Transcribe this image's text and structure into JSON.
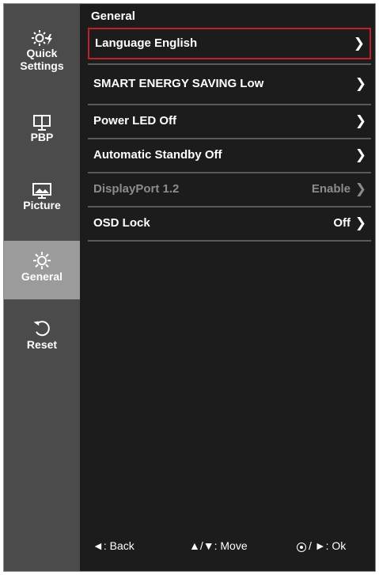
{
  "sidebar": {
    "items": [
      {
        "label_line1": "Quick",
        "label_line2": "Settings",
        "icon": "quick-settings-icon"
      },
      {
        "label": "PBP",
        "icon": "pbp-icon"
      },
      {
        "label": "Picture",
        "icon": "picture-icon"
      },
      {
        "label": "General",
        "icon": "gear-icon",
        "active": true
      },
      {
        "label": "Reset",
        "icon": "reset-icon"
      }
    ]
  },
  "main": {
    "title": "General",
    "rows": [
      {
        "label": "Language English",
        "value": "",
        "chevron": "❯",
        "selected": true
      },
      {
        "label": "SMART ENERGY SAVING Low",
        "value": "",
        "chevron": "❯"
      },
      {
        "label": "Power LED Off",
        "value": "",
        "chevron": "❯"
      },
      {
        "label": "Automatic Standby Off",
        "value": "",
        "chevron": "❯"
      },
      {
        "label": "DisplayPort 1.2",
        "value": "Enable",
        "chevron": "❯",
        "disabled": true
      },
      {
        "label": "OSD Lock",
        "value": "Off",
        "chevron": "❯"
      }
    ]
  },
  "footer": {
    "back": "◄: Back",
    "move": "▲/▼: Move",
    "ok_suffix": "/ ►: Ok"
  },
  "colors": {
    "background": "#1c1c1c",
    "sidebar": "#4b4b4b",
    "sidebar_active": "#9b9b9b",
    "selection_border": "#c0202a",
    "disabled_text": "#8c8c8c"
  }
}
